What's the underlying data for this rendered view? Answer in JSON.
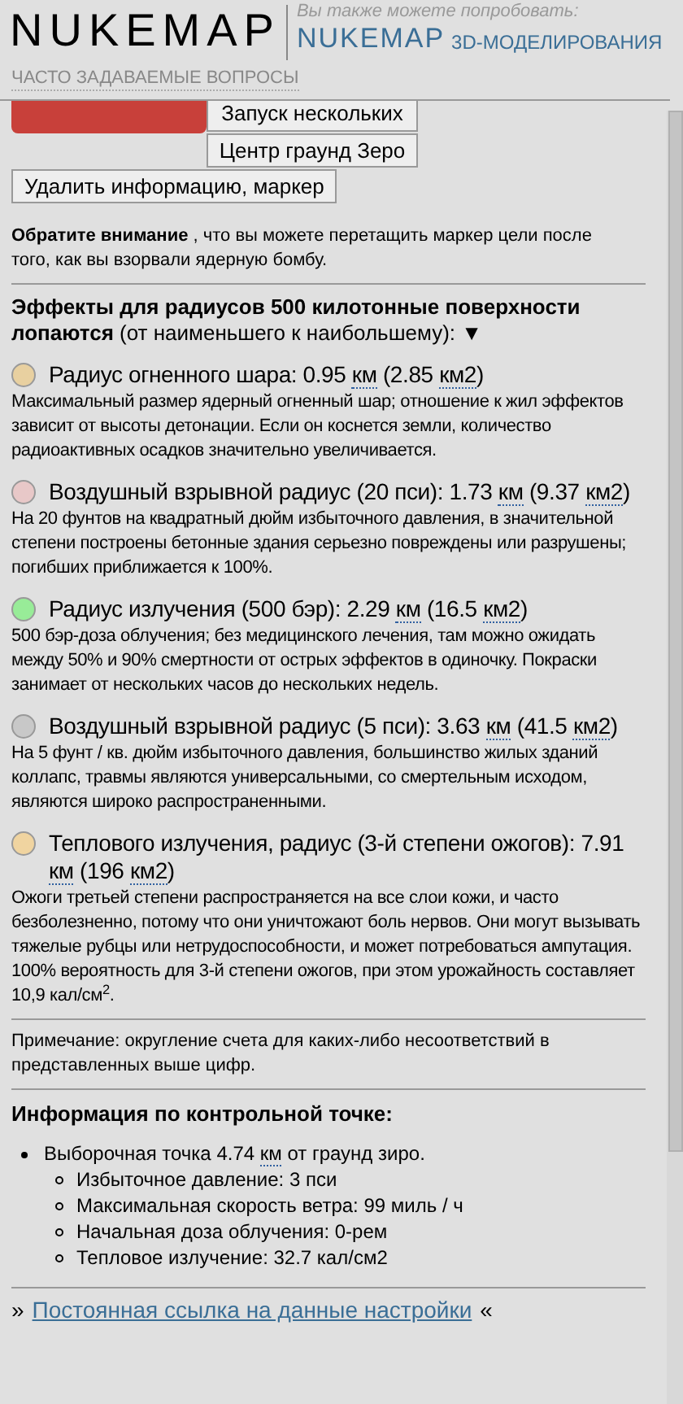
{
  "header": {
    "logo": "NUKEMAP",
    "also_try": "Вы также можете попробовать:",
    "links": [
      {
        "text": "NUKEMAP"
      },
      {
        "text": "3D-МОДЕЛИРОВАНИЯ"
      }
    ],
    "faq": "ЧАСТО ЗАДАВАЕМЫЕ ВОПРОСЫ"
  },
  "buttons": {
    "multi": "Запуск нескольких",
    "center": "Центр граунд Зеро",
    "clear": "Удалить информацию, маркер"
  },
  "notice": "**Обратите внимание** , что вы можете перетащить маркер цели после того, как вы взорвали ядерную бомбу.",
  "effects_heading": "**Эффекты для радиусов 500 килотонные поверхности лопаются** (от наименьшего к наибольшему): ▼",
  "effects": [
    {
      "color": "#e8d0a0",
      "title": [
        {
          "text": "Радиус огненного шара: 0.95 "
        },
        {
          "text": "км",
          "kind": "abbr"
        },
        {
          "text": " (2.85 "
        },
        {
          "text": "км2",
          "kind": "abbr"
        },
        {
          "text": ")"
        }
      ],
      "description": "Максимальный размер ядерный огненный шар; отношение к жил эффектов зависит от высоты детонации. Если он коснется земли, количество радиоактивных осадков значительно увеличивается."
    },
    {
      "color": "#e8c8c8",
      "title": [
        {
          "text": "Воздушный взрывной радиус (20 пси): 1.73 "
        },
        {
          "text": "км",
          "kind": "abbr"
        },
        {
          "text": " (9.37 "
        },
        {
          "text": "км2",
          "kind": "abbr"
        },
        {
          "text": ")"
        }
      ],
      "description": "На 20 фунтов на квадратный дюйм избыточного давления, в значительной степени построены бетонные здания серьезно повреждены или разрушены; погибших приближается к 100%."
    },
    {
      "color": "#98ec98",
      "title": [
        {
          "text": "Радиус излучения (500 бэр): 2.29 "
        },
        {
          "text": "км",
          "kind": "abbr"
        },
        {
          "text": " (16.5 "
        },
        {
          "text": "км2",
          "kind": "abbr"
        },
        {
          "text": ")"
        }
      ],
      "description": "500 бэр-доза облучения; без медицинского лечения, там можно ожидать между 50% и 90% смертности от острых эффектов в одиночку. Покраски занимает от нескольких часов до нескольких недель."
    },
    {
      "color": "#c8c8c8",
      "title": [
        {
          "text": "Воздушный взрывной радиус (5 пси): 3.63 "
        },
        {
          "text": "км",
          "kind": "abbr"
        },
        {
          "text": " (41.5 "
        },
        {
          "text": "км2",
          "kind": "abbr"
        },
        {
          "text": ")"
        }
      ],
      "description": "На 5 фунт / кв. дюйм избыточного давления, большинство жилых зданий коллапс, травмы являются универсальными, со смертельным исходом, являются широко распространенными."
    },
    {
      "color": "#f0d4a0",
      "title": [
        {
          "text": "Теплового излучения, радиус (3-й степени ожогов): 7.91 "
        },
        {
          "text": "км",
          "kind": "abbr"
        },
        {
          "text": " (196 "
        },
        {
          "text": "км2",
          "kind": "abbr"
        },
        {
          "text": ")"
        }
      ],
      "description": "Ожоги третьей степени распространяется на все слои кожи, и часто безболезненно, потому что они уничтожают боль нервов. Они могут вызывать тяжелые рубцы или нетрудоспособности, и может потребоваться ампутация. 100% вероятность для 3-й степени ожогов, при этом урожайность составляет 10,9 кал/см$^{2}$."
    }
  ],
  "rounding_note": "Примечание: округление счета для каких-либо несоответствий в представленных выше цифр.",
  "checkpoint": {
    "heading": "Информация по контрольной точке:",
    "items": [
      {
        "parts": [
          {
            "text": "Выборочная точка 4.74 "
          },
          {
            "text": "км",
            "kind": "abbr"
          },
          {
            "text": " от граунд зиро."
          }
        ],
        "children": [
          {
            "parts": [
              {
                "text": "Избыточное давление: 3 пси"
              }
            ]
          },
          {
            "parts": [
              {
                "text": "Максимальная скорость ветра: 99 миль / ч"
              }
            ]
          },
          {
            "parts": [
              {
                "text": "Начальная доза облучения: 0-рем"
              }
            ]
          },
          {
            "parts": [
              {
                "text": "Тепловое излучение: 32.7 кал/см2"
              }
            ]
          }
        ]
      }
    ]
  },
  "permalink": {
    "before": "»",
    "link": "Постоянная ссылка на данные настройки",
    "after": "«"
  }
}
